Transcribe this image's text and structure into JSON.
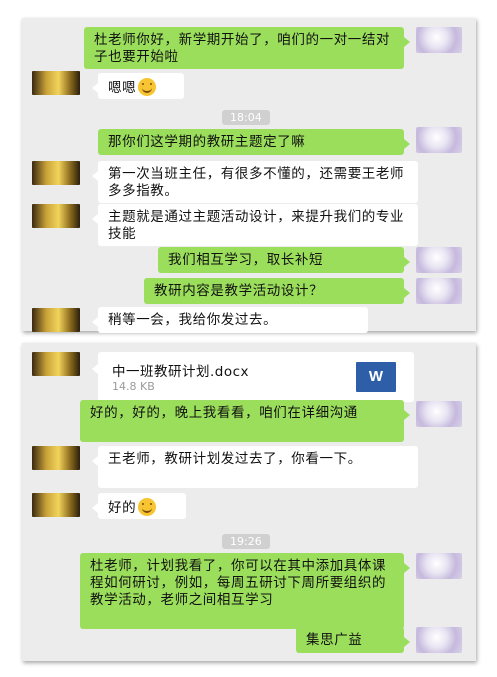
{
  "chat": {
    "panel1": {
      "m1": "杜老师你好，新学期开始了，咱们的一对一结对子也要开始啦",
      "m2": "嗯嗯",
      "time1": "18:04",
      "m3": "那你们这学期的教研主题定了嘛",
      "m4": "第一次当班主任，有很多不懂的，还需要王老师多多指教。",
      "m5": "主题就是通过主题活动设计，来提升我们的专业技能",
      "m6": "我们相互学习，取长补短",
      "m7": "教研内容是教学活动设计？",
      "m8": "稍等一会，我给你发过去。"
    },
    "panel2": {
      "file_name": "中一班教研计划.docx",
      "file_size": "14.8 KB",
      "file_icon_text": "W",
      "file_icon": "word-document-icon",
      "m9": "好的，好的，晚上我看看，咱们在详细沟通",
      "m10": "王老师，教研计划发过去了，你看一下。",
      "m11": "好的",
      "time2": "19:26",
      "m12": "杜老师，计划我看了，你可以在其中添加具体课程如何研讨，例如，每周五研讨下周所要组织的教学活动，老师之间相互学习",
      "m13": "集思广益"
    }
  },
  "colors": {
    "panel_bg": "#ececec",
    "self_bubble": "#9bde5c",
    "other_bubble": "#ffffff",
    "word_icon": "#2f5ea8"
  }
}
